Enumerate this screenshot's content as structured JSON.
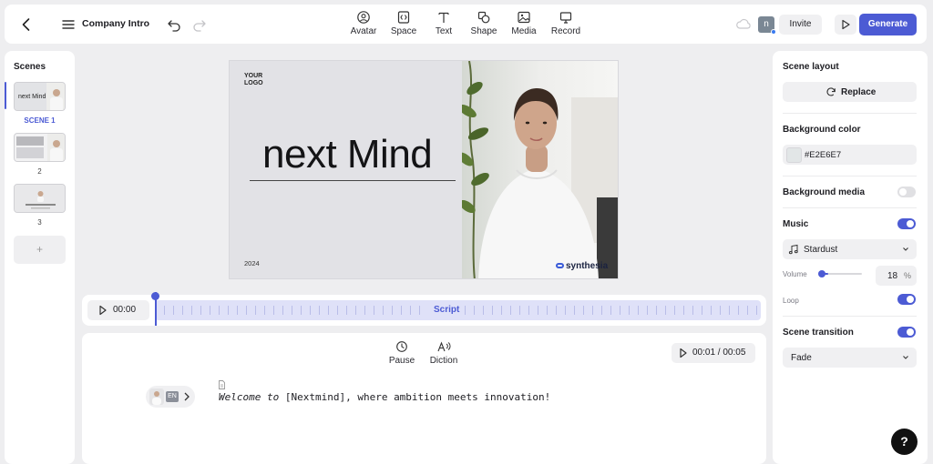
{
  "header": {
    "project_title": "Company Intro",
    "tools": [
      {
        "label": "Avatar",
        "icon": "avatar-icon"
      },
      {
        "label": "Space",
        "icon": "space-icon"
      },
      {
        "label": "Text",
        "icon": "text-icon"
      },
      {
        "label": "Shape",
        "icon": "shape-icon"
      },
      {
        "label": "Media",
        "icon": "media-icon"
      },
      {
        "label": "Record",
        "icon": "record-icon"
      }
    ],
    "user_initial": "n",
    "invite_label": "Invite",
    "generate_label": "Generate"
  },
  "scenes": {
    "title": "Scenes",
    "items": [
      {
        "label": "SCENE 1",
        "active": true
      },
      {
        "label": "2",
        "active": false
      },
      {
        "label": "3",
        "active": false
      }
    ],
    "add_label": "+"
  },
  "canvas": {
    "logo_text": "YOUR\nLOGO",
    "headline": "next Mind",
    "year": "2024",
    "brand": "synthesia",
    "background_color": "#E2E6E7"
  },
  "timeline": {
    "current_time": "00:00",
    "track_label": "Script"
  },
  "script": {
    "tools": [
      {
        "label": "Pause",
        "icon": "clock-icon"
      },
      {
        "label": "Diction",
        "icon": "diction-icon"
      }
    ],
    "duration": "00:01 / 00:05",
    "voice_lang": "EN",
    "line_italic": "Welcome to",
    "line_rest": " [Nextmind], where ambition meets innovation!"
  },
  "properties": {
    "scene_layout_label": "Scene layout",
    "replace_label": "Replace",
    "background_color_label": "Background color",
    "background_color_value": "#E2E6E7",
    "background_media_label": "Background media",
    "background_media_on": false,
    "music_label": "Music",
    "music_on": true,
    "music_track": "Stardust",
    "volume_label": "Volume",
    "volume_value": "18",
    "volume_unit": "%",
    "loop_label": "Loop",
    "loop_on": true,
    "scene_transition_label": "Scene transition",
    "scene_transition_on": true,
    "transition_value": "Fade"
  },
  "help_label": "?",
  "colors": {
    "accent": "#4c5bd4",
    "app_background": "#eeeef0"
  }
}
